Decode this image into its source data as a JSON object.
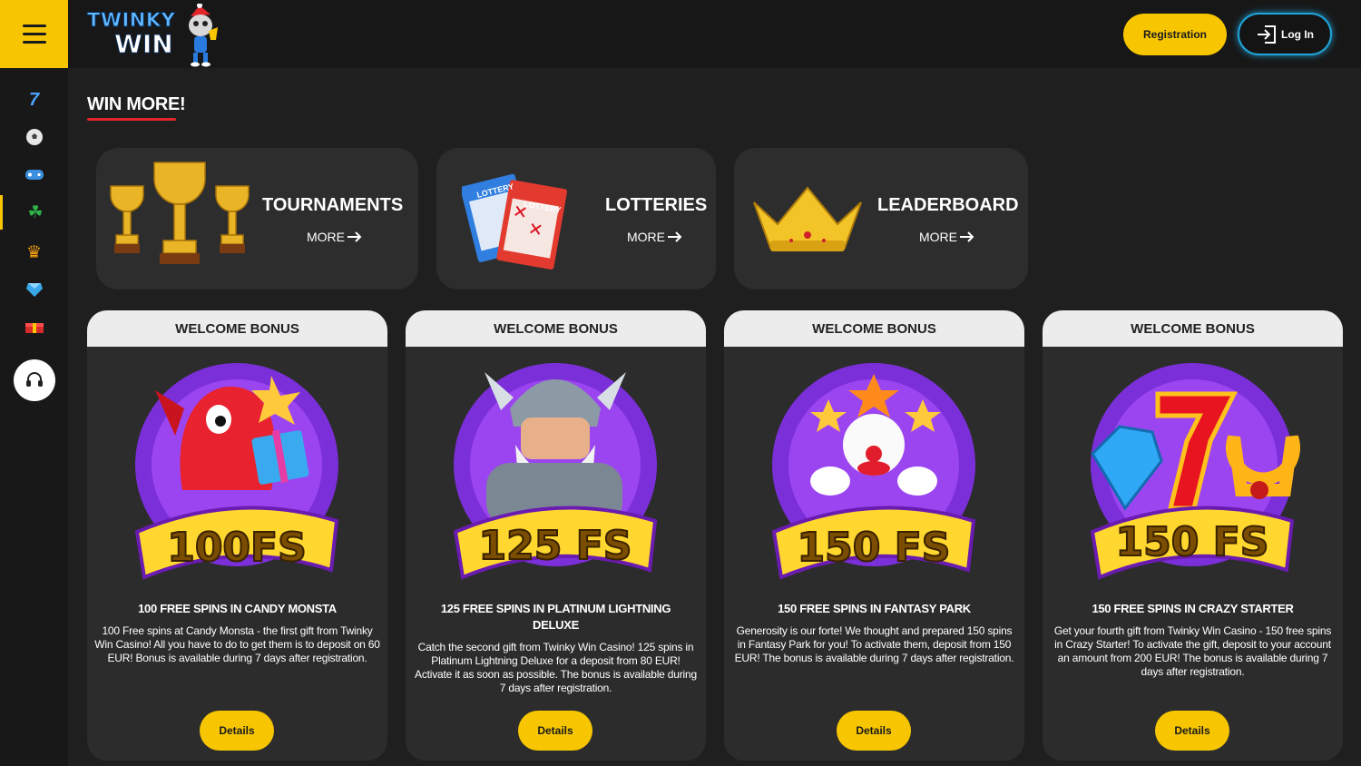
{
  "header": {
    "logo_line1": "TWINKY",
    "logo_line2": "WIN",
    "registration_label": "Registration",
    "login_label": "Log In"
  },
  "sidebar": {
    "items": [
      {
        "icon": "seven-icon",
        "glyph": "7"
      },
      {
        "icon": "soccer-ball-icon",
        "glyph": "⚽"
      },
      {
        "icon": "gamepad-icon",
        "glyph": "🎮"
      },
      {
        "icon": "clover-icon",
        "glyph": "☘"
      },
      {
        "icon": "crown-icon",
        "glyph": "♛"
      },
      {
        "icon": "gem-icon",
        "glyph": "◆"
      },
      {
        "icon": "gift-icon",
        "glyph": "▰"
      }
    ],
    "support_icon": "headset-icon"
  },
  "page": {
    "heading": "WIN MORE!"
  },
  "promos": [
    {
      "title": "TOURNAMENTS",
      "more": "MORE"
    },
    {
      "title": "LOTTERIES",
      "more": "MORE",
      "ticket1": "LOTTERY",
      "ticket2": "LOTTERY"
    },
    {
      "title": "LEADERBOARD",
      "more": "MORE"
    }
  ],
  "bonuses": [
    {
      "header": "WELCOME BONUS",
      "badge": "100FS",
      "title": "100 FREE SPINS IN CANDY MONSTA",
      "description": "100 Free spins at Candy Monsta - the first gift from Twinky Win Casino! All you have to do to get them is to deposit on 60 EUR! Bonus is available during 7 days after registration.",
      "button": "Details"
    },
    {
      "header": "WELCOME BONUS",
      "badge": "125 FS",
      "title": "125 FREE SPINS IN PLATINUM LIGHTNING DELUXE",
      "description": "Catch the second gift from Twinky Win Casino! 125 spins in Platinum Lightning Deluxe for a deposit from 80 EUR! Activate it as soon as possible. The bonus is available during 7 days after registration.",
      "button": "Details"
    },
    {
      "header": "WELCOME BONUS",
      "badge": "150 FS",
      "title": "150 FREE SPINS IN FANTASY PARK",
      "description": "Generosity is our forte! We thought and prepared 150 spins in Fantasy Park for you! To activate them, deposit from 150 EUR! The bonus is available during 7 days after registration.",
      "button": "Details"
    },
    {
      "header": "WELCOME BONUS",
      "badge": "150 FS",
      "title": "150 FREE SPINS IN CRAZY STARTER",
      "description": "Get your fourth gift from Twinky Win Casino - 150 free spins in Crazy Starter! To activate the gift, deposit to your account an amount from 200 EUR! The bonus is available during 7 days after registration.",
      "button": "Details"
    }
  ]
}
